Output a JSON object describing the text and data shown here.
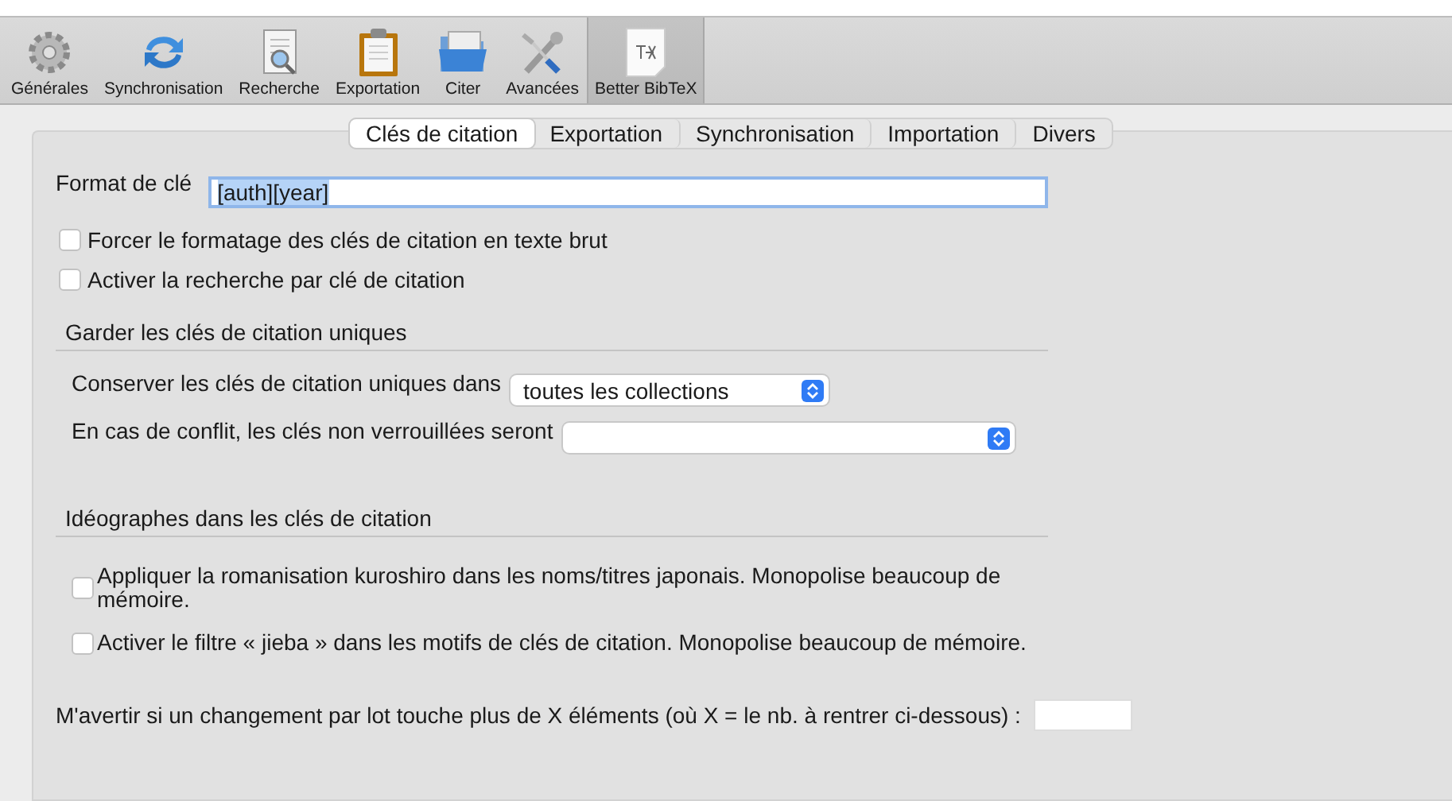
{
  "toolbar": [
    {
      "label": "Générales",
      "selected": false
    },
    {
      "label": "Synchronisation",
      "selected": false
    },
    {
      "label": "Recherche",
      "selected": false
    },
    {
      "label": "Exportation",
      "selected": false
    },
    {
      "label": "Citer",
      "selected": false
    },
    {
      "label": "Avancées",
      "selected": false
    },
    {
      "label": "Better BibTeX",
      "selected": true
    }
  ],
  "tabs": [
    {
      "label": "Clés de citation",
      "selected": true
    },
    {
      "label": "Exportation",
      "selected": false
    },
    {
      "label": "Synchronisation",
      "selected": false
    },
    {
      "label": "Importation",
      "selected": false
    },
    {
      "label": "Divers",
      "selected": false
    }
  ],
  "key_format": {
    "label": "Format de clé",
    "value": "[auth][year]"
  },
  "options": [
    {
      "label": "Forcer le formatage des clés de citation en texte brut",
      "checked": false
    },
    {
      "label": "Activer la recherche par clé de citation",
      "checked": false
    }
  ],
  "unique_section": {
    "title": "Garder les clés de citation uniques",
    "selects": [
      {
        "label": "Conserver les clés de citation uniques dans",
        "value": "toutes les collections"
      },
      {
        "label": "En cas de conflit, les clés non verrouillées seront"
      }
    ]
  },
  "ideograph_section": {
    "title": "Idéographes dans les clés de citation",
    "options": [
      {
        "label": "Appliquer la romanisation kuroshiro dans les noms/titres japonais. Monopolise beaucoup de mémoire.",
        "checked": false
      },
      {
        "label": "Activer le filtre « jieba » dans les motifs de clés de citation. Monopolise beaucoup de mémoire.",
        "checked": false
      }
    ]
  },
  "warn": {
    "label": "M'avertir si un changement par lot touche plus de X éléments (où X = le nb. à rentrer ci-dessous) :"
  }
}
